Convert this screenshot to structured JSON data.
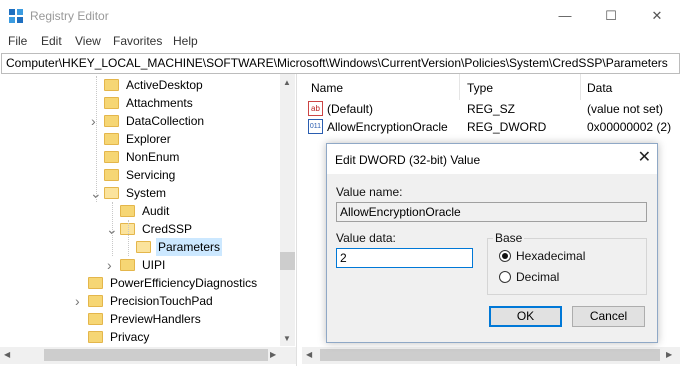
{
  "window": {
    "title": "Registry Editor",
    "minimize_glyph": "—",
    "maximize_glyph": "☐",
    "close_glyph": "✕"
  },
  "menu": [
    "File",
    "Edit",
    "View",
    "Favorites",
    "Help"
  ],
  "address": "Computer\\HKEY_LOCAL_MACHINE\\SOFTWARE\\Microsoft\\Windows\\CurrentVersion\\Policies\\System\\CredSSP\\Parameters",
  "tree": [
    {
      "label": "ActiveDesktop",
      "icon": "folder-icon",
      "expander": ""
    },
    {
      "label": "Attachments",
      "icon": "folder-icon",
      "expander": ""
    },
    {
      "label": "DataCollection",
      "icon": "folder-icon",
      "expander": ">"
    },
    {
      "label": "Explorer",
      "icon": "folder-icon",
      "expander": ""
    },
    {
      "label": "NonEnum",
      "icon": "folder-icon",
      "expander": ""
    },
    {
      "label": "Servicing",
      "icon": "folder-icon",
      "expander": ""
    },
    {
      "label": "System",
      "icon": "folder-open-icon",
      "expander": "v"
    },
    {
      "label": "Audit",
      "icon": "folder-icon",
      "expander": ""
    },
    {
      "label": "CredSSP",
      "icon": "folder-open-icon",
      "expander": "v"
    },
    {
      "label": "Parameters",
      "icon": "folder-open-icon",
      "expander": "",
      "selected": true
    },
    {
      "label": "UIPI",
      "icon": "folder-icon",
      "expander": ">"
    },
    {
      "label": "PowerEfficiencyDiagnostics",
      "icon": "folder-icon",
      "expander": ""
    },
    {
      "label": "PrecisionTouchPad",
      "icon": "folder-icon",
      "expander": ">"
    },
    {
      "label": "PreviewHandlers",
      "icon": "folder-icon",
      "expander": ""
    },
    {
      "label": "Privacy",
      "icon": "folder-icon",
      "expander": ""
    }
  ],
  "list": {
    "columns": [
      "Name",
      "Type",
      "Data"
    ],
    "rows": [
      {
        "name": "(Default)",
        "type": "REG_SZ",
        "data": "(value not set)",
        "icon": "string-value-icon",
        "icon_text": "ab"
      },
      {
        "name": "AllowEncryptionOracle",
        "type": "REG_DWORD",
        "data": "0x00000002 (2)",
        "icon": "binary-value-icon",
        "icon_text": "011"
      }
    ]
  },
  "dialog": {
    "title": "Edit DWORD (32-bit) Value",
    "close_glyph": "✕",
    "value_name_label": "Value name:",
    "value_name": "AllowEncryptionOracle",
    "value_data_label": "Value data:",
    "value_data": "2",
    "base_label": "Base",
    "options": [
      "Hexadecimal",
      "Decimal"
    ],
    "selected_base": "Hexadecimal",
    "ok": "OK",
    "cancel": "Cancel"
  },
  "colors": {
    "selection": "#cce8ff",
    "accent": "#0078d7",
    "folder": "#f6d674"
  }
}
